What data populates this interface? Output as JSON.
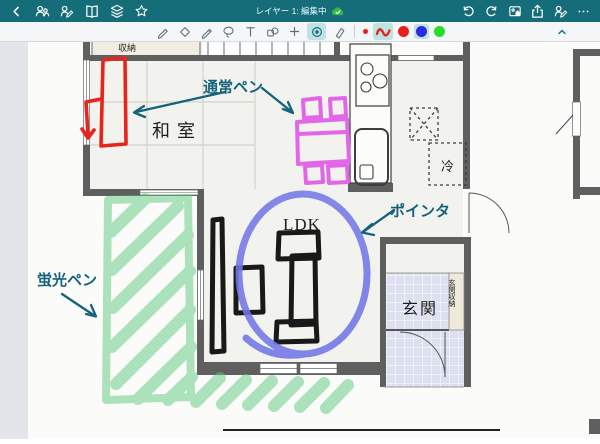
{
  "topbar": {
    "title": "レイヤー 1: 編集中",
    "bar_color": "#156d79",
    "left_icons": [
      "back",
      "collaboration",
      "handwriting-share",
      "library",
      "layers",
      "favorites"
    ],
    "sync_icon": "cloud-check",
    "right_icons": [
      "undo",
      "redo",
      "save-page",
      "share",
      "add-note",
      "more"
    ]
  },
  "toolbar": {
    "tools": [
      "pen-1",
      "marker",
      "pen-2",
      "lasso",
      "text",
      "shapes",
      "add",
      "laser-pointer",
      "eraser"
    ],
    "selected_tool": "laser-pointer",
    "stroke_preview": "red-squiggle",
    "palette": [
      {
        "name": "current-size-dot",
        "color": "#e81f17"
      },
      {
        "name": "red",
        "color": "#e81f17"
      },
      {
        "name": "blue",
        "color": "#2a2ae3",
        "selected": true
      },
      {
        "name": "green",
        "color": "#25dd25"
      }
    ],
    "collapse_icon": "chevron-up"
  },
  "floorplan": {
    "labels": {
      "closet": "収納",
      "washitsu": "和室",
      "ldk": "LDK",
      "fridge": "冷",
      "entrance": "玄関",
      "entrance_storage": "玄関収納"
    }
  },
  "annotations": {
    "normal_pen_label": "通常ペン",
    "pointer_label": "ポインタ",
    "highlighter_label": "蛍光ペン",
    "colors": {
      "normal_pen": "#e6251c",
      "magenta_pen": "#e266e8",
      "black_pen": "#191919",
      "pointer": "#7277e8",
      "highlighter": "#5ecb80",
      "label_text": "#14627c"
    }
  }
}
